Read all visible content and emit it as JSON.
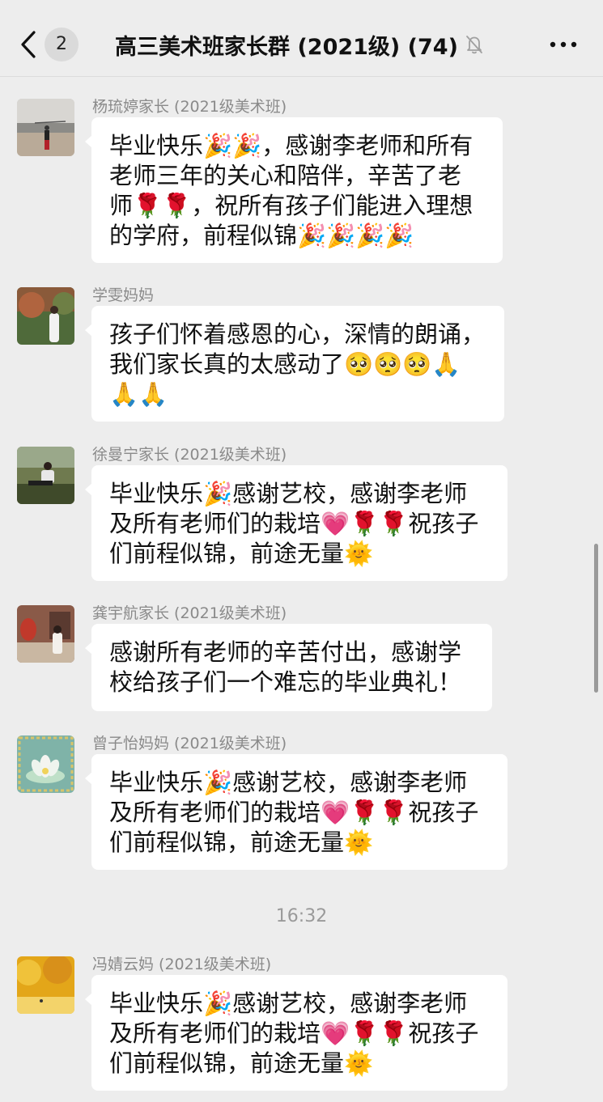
{
  "header": {
    "unread_count": "2",
    "title": "高三美术班家长群 (2021级) (74)"
  },
  "messages": [
    {
      "sender": "杨琉婷家长 (2021级美术班)",
      "lines": [
        "毕业快乐🎉🎉，感谢李老师和所有",
        "老师三年的关心和陪伴，辛苦了老",
        "师🌹🌹，祝所有孩子们能进入理想",
        "的学府，前程似锦🎉🎉🎉🎉"
      ]
    },
    {
      "sender": "学雯妈妈",
      "lines": [
        "孩子们怀着感恩的心，深情的朗诵，",
        "我们家长真的太感动了🥺🥺🥺🙏",
        "🙏🙏"
      ]
    },
    {
      "sender": "徐曼宁家长 (2021级美术班)",
      "lines": [
        "毕业快乐🎉感谢艺校，感谢李老师",
        "及所有老师们的栽培💗🌹🌹祝孩子",
        "们前程似锦，前途无量🌞"
      ]
    },
    {
      "sender": "龚宇航家长 (2021级美术班)",
      "lines": [
        "感谢所有老师的辛苦付出，感谢学",
        "校给孩子们一个难忘的毕业典礼！"
      ]
    },
    {
      "sender": "曾子怡妈妈 (2021级美术班)",
      "lines": [
        "毕业快乐🎉感谢艺校，感谢李老师",
        "及所有老师们的栽培💗🌹🌹祝孩子",
        "们前程似锦，前途无量🌞"
      ]
    },
    {
      "sender": "冯婧云妈 (2021级美术班)",
      "lines": [
        "毕业快乐🎉感谢艺校，感谢李老师",
        "及所有老师们的栽培💗🌹🌹祝孩子",
        "们前程似锦，前途无量🌞"
      ]
    }
  ],
  "timestamp": "16:32",
  "icons": {
    "back": "chevron-left-icon",
    "mute": "bell-muted-icon",
    "more": "more-dots-icon"
  },
  "colors": {
    "background": "#ededed",
    "bubble": "#ffffff",
    "sender_text": "#8a8a8a"
  }
}
